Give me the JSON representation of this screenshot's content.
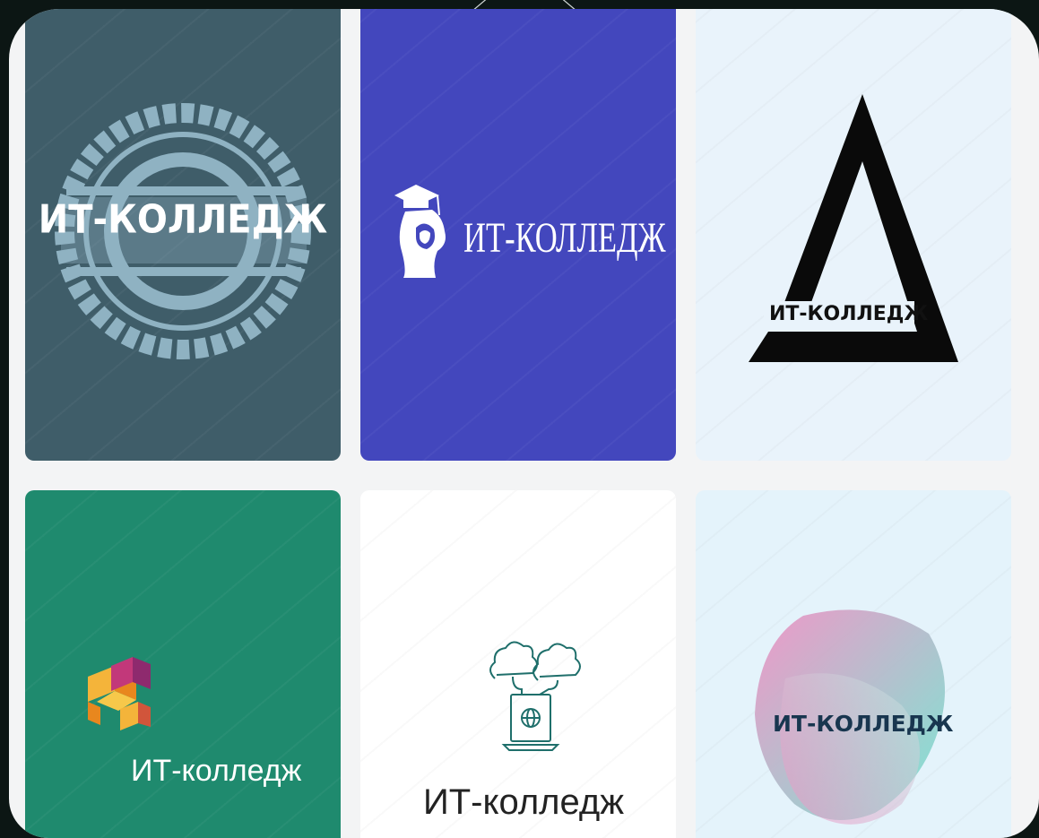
{
  "logos": [
    {
      "name": "ИТ-КОЛЛЕДЖ",
      "style": "stamp-badge",
      "background": "#3f5d69"
    },
    {
      "name": "ИТ-КОЛЛЕДЖ",
      "style": "graduate-head",
      "background": "#4347bd"
    },
    {
      "name": "ИТ-КОЛЛЕДЖ",
      "style": "triangle",
      "background": "#e9f3fb"
    },
    {
      "name": "ИТ-колледж",
      "style": "isometric-cubes",
      "background": "#1f8a6e"
    },
    {
      "name": "ИТ-колледж",
      "style": "cloud-laptop",
      "background": "#ffffff"
    },
    {
      "name": "ИТ-КОЛЛЕДЖ",
      "style": "gradient-blob",
      "background": "#e4f3fb"
    }
  ],
  "colors": {
    "page_bg": "#0c1614",
    "frame_bg": "#f3f4f5",
    "stamp": "#8fb2c2",
    "blob_pink": "#f08ec2",
    "blob_teal": "#6fe6cf"
  }
}
